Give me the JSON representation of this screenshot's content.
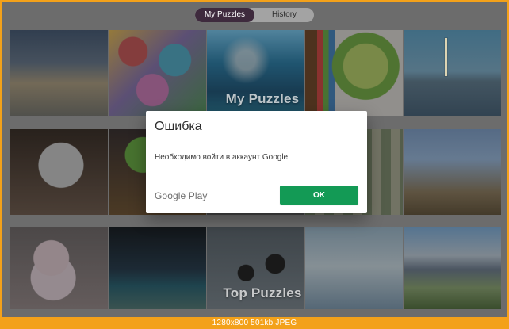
{
  "tabs": [
    {
      "label": "My Puzzles",
      "active": true
    },
    {
      "label": "History",
      "active": false
    }
  ],
  "sections": {
    "my_label": "My Puzzles",
    "top_label": "Top Puzzles"
  },
  "dialog": {
    "title": "Ошибка",
    "message": "Необходимо войти в аккаунт Google.",
    "brand": "Google Play",
    "ok_label": "OK"
  },
  "status": {
    "text": "1280x800  501kb  JPEG"
  }
}
